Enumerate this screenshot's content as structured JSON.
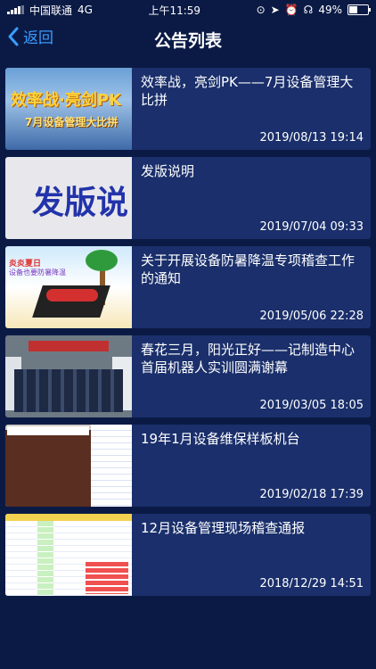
{
  "status_bar": {
    "carrier": "中国联通",
    "network": "4G",
    "time": "上午11:59",
    "battery": "49%",
    "battery_level": 0.49
  },
  "nav": {
    "back_label": "返回",
    "title": "公告列表"
  },
  "items": [
    {
      "title": "效率战，亮剑PK——7月设备管理大比拼",
      "date": "2019/08/13 19:14",
      "thumb_text": "效率战·亮剑PK",
      "thumb_sub": "7月设备管理大比拼"
    },
    {
      "title": "发版说明",
      "date": "2019/07/04 09:33",
      "thumb_text": "发版说"
    },
    {
      "title": "关于开展设备防暑降温专项稽查工作的通知",
      "date": "2019/05/06 22:28",
      "thumb_text": "炎炎夏日",
      "thumb_sub": "设备也要防暑降温"
    },
    {
      "title": "春花三月，阳光正好——记制造中心首届机器人实训圆满谢幕",
      "date": "2019/03/05 18:05"
    },
    {
      "title": "19年1月设备维保样板机台",
      "date": "2019/02/18 17:39"
    },
    {
      "title": "12月设备管理现场稽查通报",
      "date": "2018/12/29 14:51"
    }
  ],
  "colors": {
    "background": "#0b1a45",
    "card": "#1a2f6b",
    "accent": "#3a9cff"
  }
}
